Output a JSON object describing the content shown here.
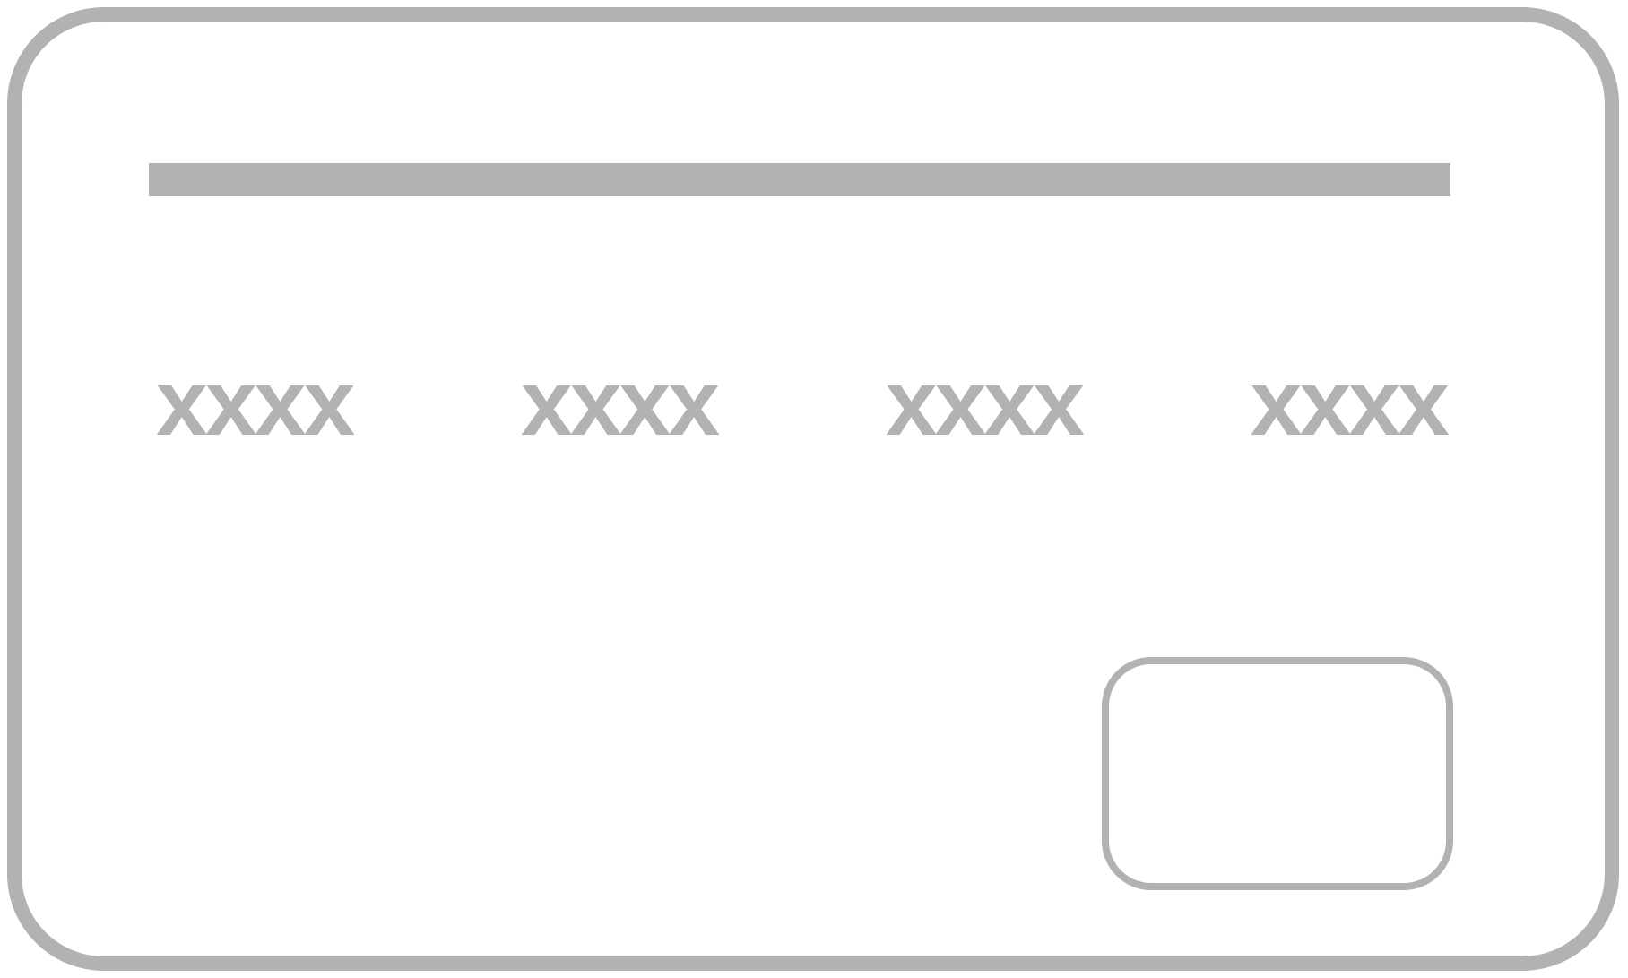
{
  "card": {
    "number_groups": [
      "xxxx",
      "xxxx",
      "xxxx",
      "xxxx"
    ],
    "colors": {
      "outline": "#b2b2b2",
      "background": "#ffffff"
    }
  }
}
